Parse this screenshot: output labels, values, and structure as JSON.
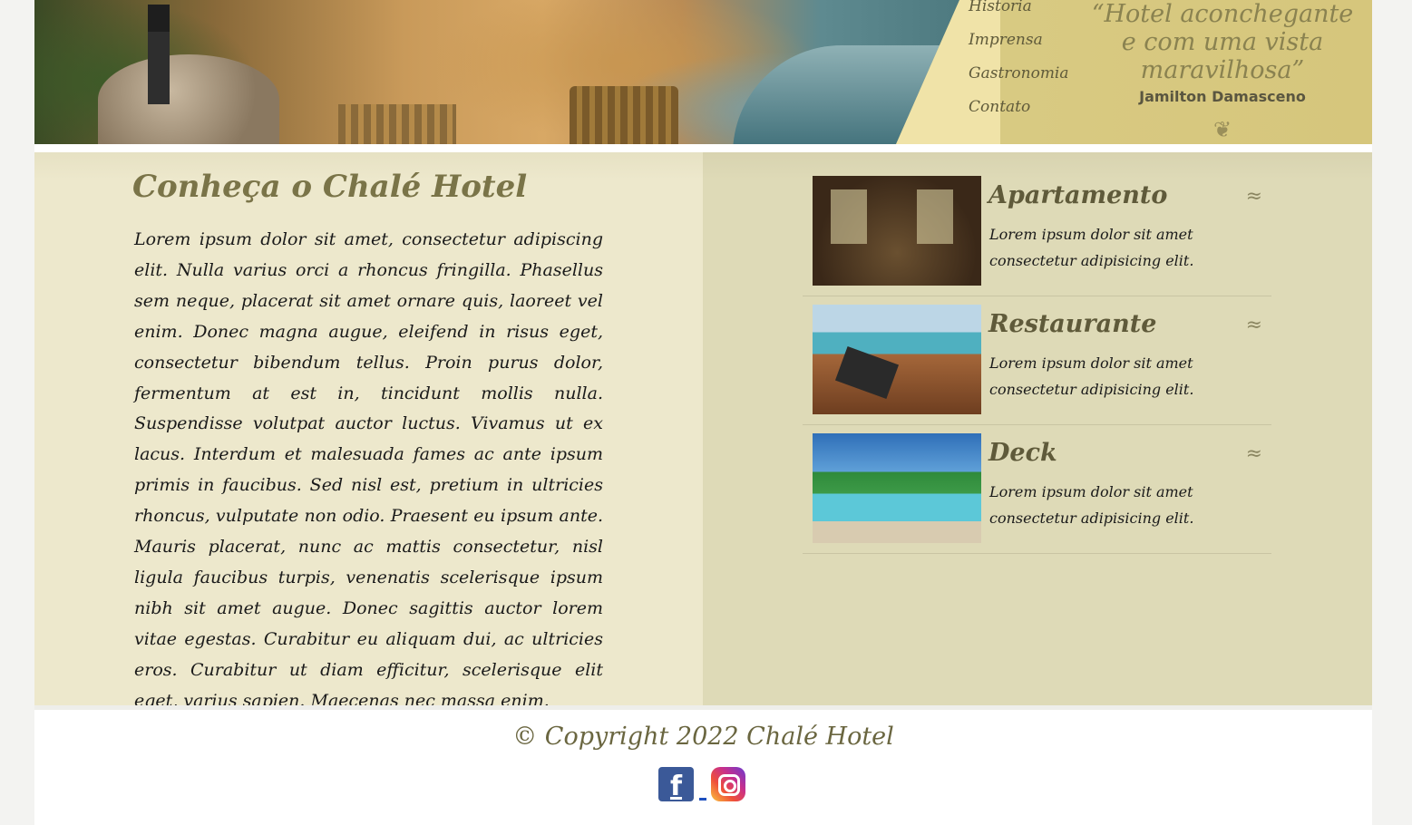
{
  "nav": {
    "items": [
      {
        "label": "Historia"
      },
      {
        "label": "Imprensa"
      },
      {
        "label": "Gastronomia"
      },
      {
        "label": "Contato"
      }
    ]
  },
  "quote": {
    "text": "“Hotel aconchegante e com uma vista maravilhosa”",
    "author": "Jamilton Damasceno"
  },
  "about": {
    "title": "Conheça o Chalé Hotel",
    "text": "Lorem ipsum dolor sit amet, consectetur adipiscing elit. Nulla varius orci a rhoncus fringilla. Phasellus sem neque, placerat sit amet ornare quis, laoreet vel enim. Donec magna augue, eleifend in risus eget, consectetur bibendum tellus. Proin purus dolor, fermentum at est in, tincidunt mollis nulla. Suspendisse volutpat auctor luctus. Vivamus ut ex lacus. Interdum et malesuada fames ac ante ipsum primis in faucibus. Sed nisl est, pretium in ultricies rhoncus, vulputate non odio. Praesent eu ipsum ante. Mauris placerat, nunc ac mattis consectetur, nisl ligula faucibus turpis, venenatis scelerisque ipsum nibh sit amet augue. Donec sagittis auctor lorem vitae egestas. Curabitur eu aliquam dui, ac ultricies eros. Curabitur ut diam efficitur, scelerisque elit eget, varius sapien. Maecenas nec massa enim."
  },
  "cards": [
    {
      "title": "Apartamento",
      "text": "Lorem ipsum dolor sit amet consectetur adipisicing elit."
    },
    {
      "title": "Restaurante",
      "text": "Lorem ipsum dolor sit amet consectetur adipisicing elit."
    },
    {
      "title": "Deck",
      "text": "Lorem ipsum dolor sit amet consectetur adipisicing elit."
    }
  ],
  "footer": {
    "copyright": "© Copyright 2022 Chalé Hotel",
    "social": [
      {
        "icon": "facebook-icon"
      },
      {
        "icon": "instagram-icon"
      }
    ]
  },
  "colors": {
    "heading": "#7a7448",
    "left_bg": "#ede8cc",
    "right_bg": "#dedab7",
    "band": "#d9cb84"
  }
}
